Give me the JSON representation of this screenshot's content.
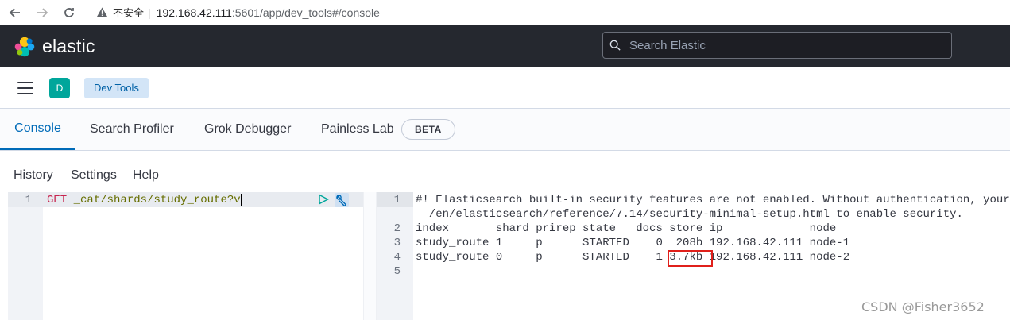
{
  "browser": {
    "security_label": "不安全",
    "url_host": "192.168.42.111",
    "url_rest": ":5601/app/dev_tools#/console"
  },
  "header": {
    "logo_text": "elastic",
    "search_placeholder": "Search Elastic"
  },
  "subheader": {
    "avatar_letter": "D",
    "breadcrumb": "Dev Tools"
  },
  "tabs": {
    "console": "Console",
    "search_profiler": "Search Profiler",
    "grok_debugger": "Grok Debugger",
    "painless_lab": "Painless Lab",
    "beta_badge": "BETA"
  },
  "menu": {
    "history": "History",
    "settings": "Settings",
    "help": "Help"
  },
  "request": {
    "line_number": "1",
    "method": "GET",
    "path": "_cat/shards/study_route?v"
  },
  "response": {
    "line_numbers": [
      "1",
      "2",
      "3",
      "4",
      "5"
    ],
    "lines": [
      "#! Elasticsearch built-in security features are not enabled. Without authentication, your",
      "  /en/elasticsearch/reference/7.14/security-minimal-setup.html to enable security.",
      "index       shard prirep state   docs store ip             node",
      "study_route 1     p      STARTED    0  208b 192.168.42.111 node-1",
      "study_route 0     p      STARTED    1 3.7kb 192.168.42.111 node-2"
    ]
  },
  "colors": {
    "header_bg": "#25282f",
    "accent": "#006bb8",
    "highlight": "#e0201b"
  },
  "watermark": "CSDN @Fisher3652"
}
